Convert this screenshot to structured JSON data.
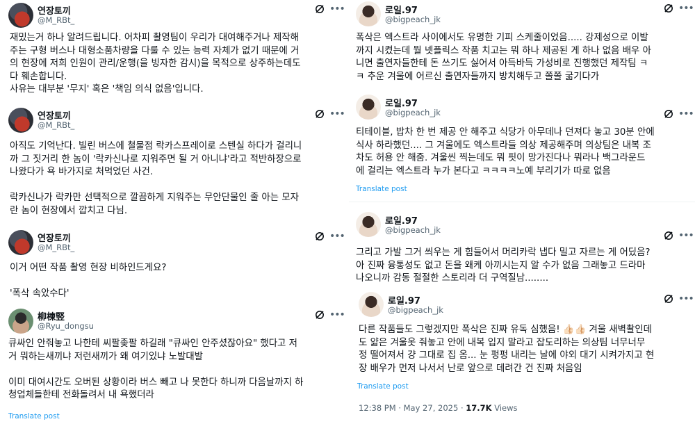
{
  "left": {
    "t1": {
      "name": "연장토끼",
      "handle": "@M_RBt_",
      "lines": [
        "재밌는거 하나 알려드립니다. 어차피 촬영팀이 우리가 대여해주거나 제작해",
        "주는 구형 버스나 대형소품차량을 다룰 수 있는 능력 자체가 없기 때문에 거",
        "의 현장에 저희 인원이 관리/운행(을 빙자한 감시)을 목적으로 상주하는데도",
        "다 훼손합니다.",
        "사유는 대부분 '무지' 혹은 '책임 의식 없음'입니다."
      ]
    },
    "t2": {
      "name": "연장토끼",
      "handle": "@M_RBt_",
      "lines": [
        "아직도 기억난다. 빌린 버스에 철물점 락카스프레이로 스텐실 하다가 걸리니",
        "까 그 짓거리 한 놈이 '락카신나로 지워주면 될 거 아니냐'라고 적반하장으로",
        "나왔다가 욕 바가지로 처먹었던 사건.",
        "",
        "락카신나가 락카만 선택적으로 깔끔하게 지워주는 무안단물인 줄 아는 모자",
        "란 놈이 현장에서 깝치고 다님."
      ]
    },
    "t3": {
      "name": "연장토끼",
      "handle": "@M_RBt_",
      "lines": [
        "이거 어떤 작품 촬영 현장 비하인드게요?",
        "",
        "'폭삭 속았수다'"
      ]
    },
    "t4": {
      "name": "柳棟竪",
      "handle": "@Ryu_dongsu",
      "lines": [
        "큐싸인 안줘놓고 나한테 씨팔좆팔 하길래 \"큐싸인 안주셨잖아요\" 했다고 저",
        "거 뭐하는새끼냐 저런새끼가 왜 여기있냐 노발대발",
        "",
        "이미 대여시간도 오버된 상황이라 버스 빼고 나 못한다 하니까 다음날까지 하",
        "청업체들한테 전화돌려서 내 욕했더라"
      ],
      "translate": "Translate post"
    }
  },
  "right": {
    "t1": {
      "name": "로일.97",
      "handle": "@bigpeach_jk",
      "lines": [
        "폭삭은 엑스트라 사이에서도 유명한 기피 스케줄이었음..... 강제성으로 이발",
        "까지 시켰는데 뭘 넷플릭스 작품 치고는 뭐 하나 제공된 게 하나 없음 배우 아",
        "니면 출연자들한테 돈 쓰기도 싫어서 아득바득 가성비로 진행했던 제작팀 ㅋ",
        "ㅋ 추운 겨울에 어르신 출연자들까지 방치해두고 쫄쫄 굶기다가"
      ]
    },
    "t2": {
      "name": "로일.97",
      "handle": "@bigpeach_jk",
      "lines": [
        "티테이블, 밥차 한 번 제공 안 해주고 식당가 아무데나 던져다 놓고 30분 안에",
        "식사 하라했던.... 그 겨울에도 엑스트라들 의상 제공해주며 의상팀은 내복 조",
        "차도 허용 안 해줌. 겨울씬 찍는데도 뭐 핏이 망가진다나 뭐라나 백그라운드",
        "에 걸리는 엑스트라 누가 본다고 ㅋㅋㅋㅋ노예 부리기가 따로 없음"
      ],
      "translate": "Translate post"
    },
    "t3": {
      "name": "로일.97",
      "handle": "@bigpeach_jk",
      "lines": [
        "그리고 가발 그거 씌우는 게 힘들어서 머리카락 냅다 밀고 자르는 게 어딨음?",
        "아 진짜 융통성도 없고 돈을 왜케 아끼시는지 알 수가 없음 그래놓고 드라마",
        "나오니까 감동 절절한 스토리라 더 구역질남........"
      ]
    },
    "t4": {
      "name": "로일.97",
      "handle": "@bigpeach_jk",
      "lines": [
        "다른 작품들도 그렇겠지만 폭삭은 진짜 유독 심했음! 👍🏻👍🏻 겨울 새벽촬인데",
        "도 얇은 겨울옷 줘놓고 안에 내복 입지 말라고 잡도리하는 의상팀 너무너무",
        "정 떨어져서 걍 그대로 집 옴... 눈 펑펑 내리는 날에 야외 대기 시켜가지고 현",
        "장 배우가 먼저 나서서 난로 앞으로 데려간 건 진짜 처음임"
      ],
      "translate": "Translate post",
      "time": "12:38 PM",
      "date": "May 27, 2025",
      "views_count": "17.7K",
      "views_label": "Views"
    }
  },
  "icons": {
    "grok": "grok-icon",
    "more": "more-icon"
  }
}
